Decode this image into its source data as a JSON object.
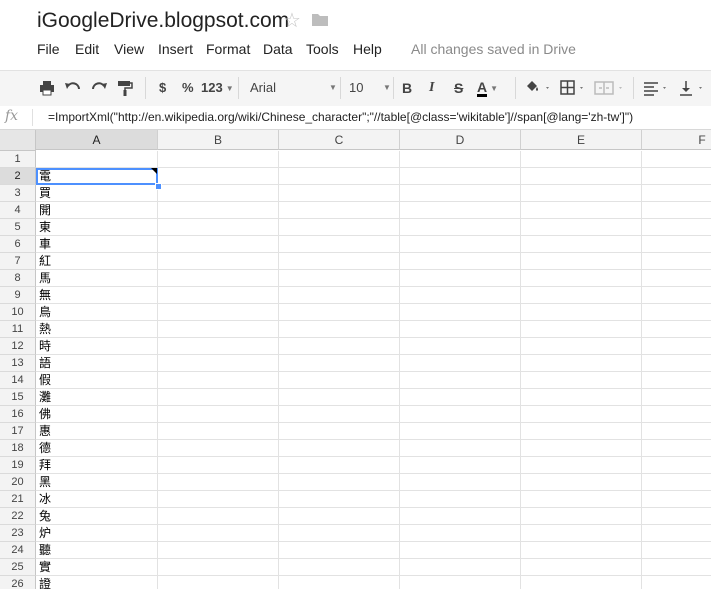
{
  "document": {
    "title": "iGoogleDrive.blogpsot.com"
  },
  "menu": {
    "items": [
      "File",
      "Edit",
      "View",
      "Insert",
      "Format",
      "Data",
      "Tools",
      "Help"
    ],
    "status": "All changes saved in Drive"
  },
  "toolbar": {
    "currency_label": "$",
    "percent_label": "%",
    "number_format_label": "123",
    "font_family": "Arial",
    "font_size": "10",
    "bold_label": "B",
    "italic_label": "I",
    "strike_label": "S",
    "text_color_label": "A",
    "icons": [
      "print-icon",
      "undo-icon",
      "redo-icon",
      "paint-format-icon",
      "fill-color-icon",
      "borders-icon",
      "merge-cells-icon",
      "align-left-icon",
      "valign-bottom-icon"
    ]
  },
  "formula_bar": {
    "fx_label": "fx",
    "formula": "=ImportXml(\"http://en.wikipedia.org/wiki/Chinese_character\";\"//table[@class='wikitable']//span[@lang='zh-tw']\")"
  },
  "sheet": {
    "columns": [
      "A",
      "B",
      "C",
      "D",
      "E",
      "F"
    ],
    "rows": [
      "1",
      "2",
      "3",
      "4",
      "5",
      "6",
      "7",
      "8",
      "9",
      "10",
      "11",
      "12",
      "13",
      "14",
      "15",
      "16",
      "17",
      "18",
      "19",
      "20",
      "21",
      "22",
      "23",
      "24",
      "25",
      "26"
    ],
    "column_a_values": [
      "",
      "電",
      "買",
      "開",
      "東",
      "車",
      "紅",
      "馬",
      "無",
      "鳥",
      "熱",
      "時",
      "語",
      "假",
      "灘",
      "佛",
      "惠",
      "德",
      "拜",
      "黑",
      "冰",
      "兔",
      "炉",
      "聽",
      "實",
      "證"
    ],
    "selected_cell": "A2",
    "colors": {
      "selection": "#4d90fe",
      "header_bg": "#f3f3f3",
      "active_header_bg": "#dcdcdc"
    }
  }
}
